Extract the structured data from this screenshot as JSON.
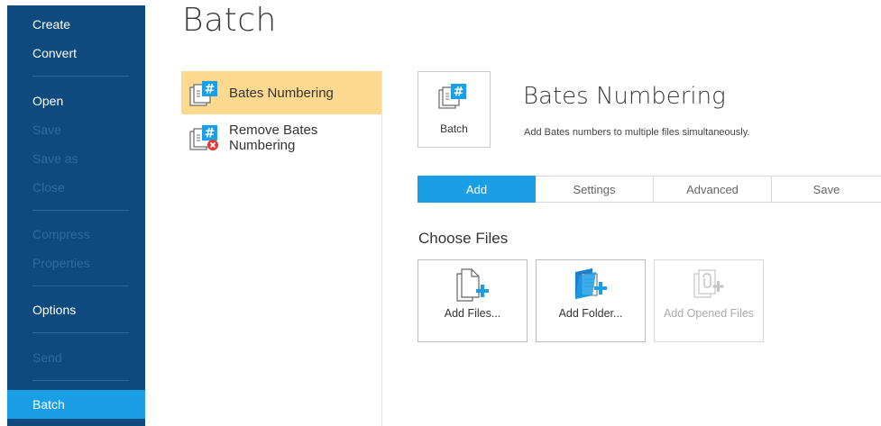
{
  "sidebar": {
    "items": [
      {
        "label": "Create",
        "enabled": true
      },
      {
        "label": "Convert",
        "enabled": true
      },
      {
        "label": "Open",
        "enabled": true
      },
      {
        "label": "Save",
        "enabled": false
      },
      {
        "label": "Save as",
        "enabled": false
      },
      {
        "label": "Close",
        "enabled": false
      },
      {
        "label": "Compress",
        "enabled": false
      },
      {
        "label": "Properties",
        "enabled": false
      },
      {
        "label": "Options",
        "enabled": true
      },
      {
        "label": "Send",
        "enabled": false
      },
      {
        "label": "Batch",
        "enabled": true,
        "active": true
      }
    ]
  },
  "page": {
    "title": "Batch"
  },
  "batch_list": {
    "items": [
      {
        "label": "Bates Numbering",
        "selected": true,
        "icon": "bates-numbering-icon"
      },
      {
        "label_line1": "Remove Bates",
        "label_line2": "Numbering",
        "selected": false,
        "icon": "remove-bates-icon"
      }
    ]
  },
  "detail": {
    "card_label": "Batch",
    "title": "Bates Numbering",
    "description": "Add Bates numbers to multiple files simultaneously."
  },
  "tabs": [
    {
      "label": "Add",
      "active": true
    },
    {
      "label": "Settings",
      "active": false
    },
    {
      "label": "Advanced",
      "active": false
    },
    {
      "label": "Save",
      "active": false
    }
  ],
  "choose_files": {
    "title": "Choose Files",
    "buttons": [
      {
        "label": "Add Files...",
        "icon": "add-files-icon",
        "enabled": true
      },
      {
        "label": "Add Folder...",
        "icon": "add-folder-icon",
        "enabled": true
      },
      {
        "label": "Add Opened Files",
        "icon": "add-opened-files-icon",
        "enabled": false
      }
    ]
  },
  "colors": {
    "sidebar_bg": "#0e4a7e",
    "accent": "#1a9ee6",
    "selection": "#fdd98f",
    "disabled_text": "#2f6aa0"
  }
}
